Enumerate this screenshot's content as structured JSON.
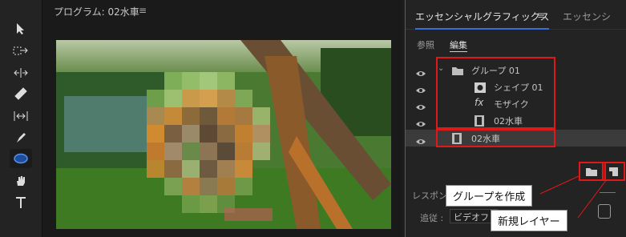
{
  "monitor": {
    "title": "プログラム: 02水車",
    "menu_icon": "hamburger-icon"
  },
  "toolbar": {
    "tools": [
      "selection-tool-icon",
      "track-select-tool-icon",
      "ripple-edit-tool-icon",
      "razor-tool-icon",
      "slip-tool-icon",
      "pen-tool-icon",
      "ellipse-tool-icon",
      "hand-tool-icon",
      "type-tool-icon"
    ]
  },
  "panel": {
    "tab_active": "エッセンシャルグラフィックス",
    "tab_menu_icon": "hamburger-icon",
    "tab_other": "エッセンシ",
    "subtabs": [
      "参照",
      "編集"
    ],
    "active_subtab": "編集",
    "layers": [
      {
        "label": "グループ 01",
        "type": "group"
      },
      {
        "label": "シェイプ 01",
        "type": "shape"
      },
      {
        "label": "モザイク",
        "type": "fx"
      },
      {
        "label": "02水車",
        "type": "clip"
      },
      {
        "label": "02水車",
        "type": "clip"
      }
    ],
    "responsive_label": "レスポン",
    "follow_label": "追従 :",
    "follow_value": "ビデオフ"
  },
  "callouts": {
    "group": "グループを作成",
    "new_layer": "新規レイヤー"
  },
  "colors": {
    "highlight_red": "#e01818",
    "accent_blue": "#3a6fd8"
  }
}
